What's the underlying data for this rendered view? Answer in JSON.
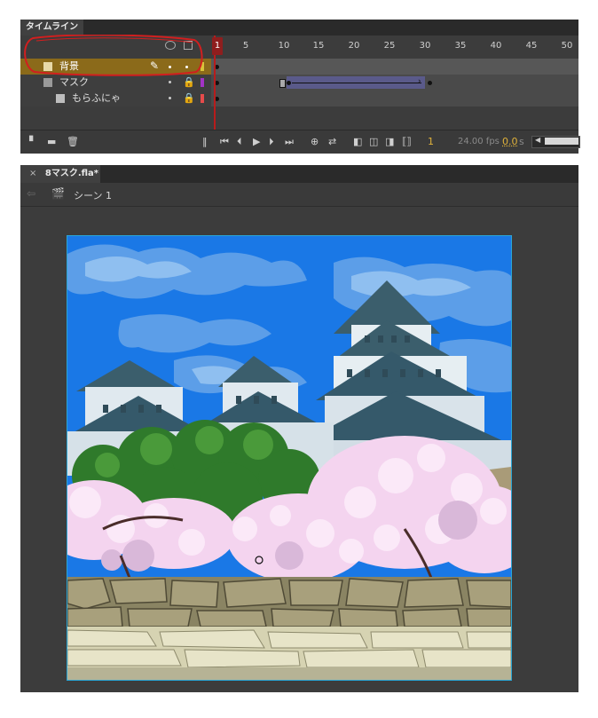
{
  "timeline": {
    "tab_title": "タイムライン",
    "ruler_numbers": [
      "1",
      "5",
      "10",
      "15",
      "20",
      "25",
      "30",
      "35",
      "40",
      "45",
      "50"
    ],
    "layers": [
      {
        "name": "背景",
        "selected": true,
        "color": "#d9c23a"
      },
      {
        "name": "マスク",
        "selected": false,
        "color": "#a233c6"
      },
      {
        "name": "もらふにゃ",
        "selected": false,
        "color": "#e64b4b"
      }
    ],
    "current_frame": "1",
    "fps": "24.00 fps",
    "time": "0.0",
    "time_unit": "s"
  },
  "document": {
    "tab_title": "8マスク.fla*",
    "close_glyph": "×",
    "scene_label": "シーン 1"
  },
  "colors": {
    "selected_row": "#8b6a1a",
    "highlight_circle": "#d11f1f",
    "tween": "#5a5a8a",
    "sky": "#1a78e6"
  }
}
